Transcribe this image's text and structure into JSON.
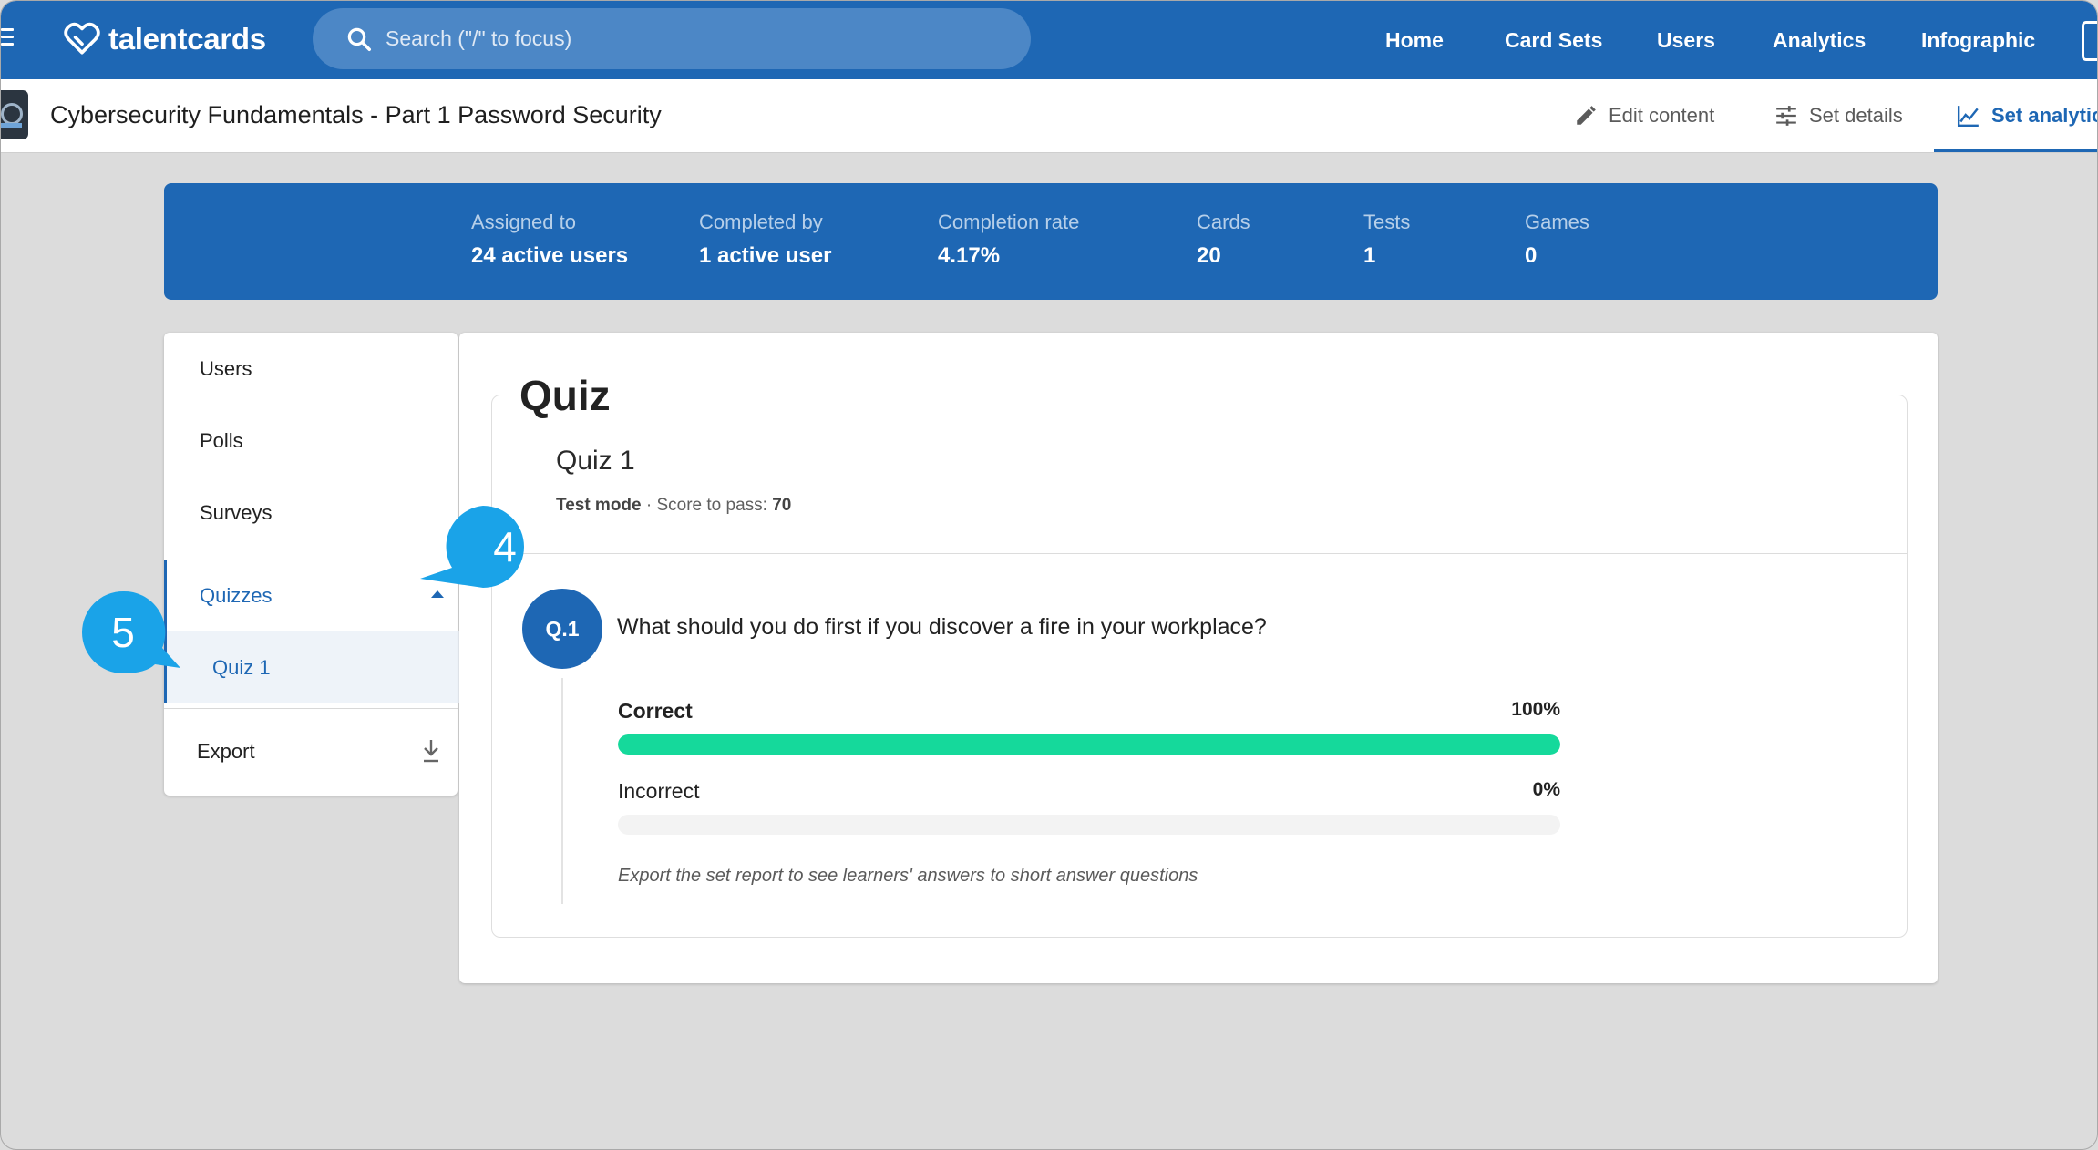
{
  "topbar": {
    "logo_text": "talentcards",
    "search_placeholder": "Search (\"/\" to focus)",
    "nav": [
      "Home",
      "Card Sets",
      "Users",
      "Analytics",
      "Infographic"
    ]
  },
  "subheader": {
    "title": "Cybersecurity Fundamentals - Part 1 Password Security",
    "tabs": [
      {
        "label": "Edit content",
        "icon": "pencil-icon"
      },
      {
        "label": "Set details",
        "icon": "sliders-icon"
      },
      {
        "label": "Set analytics",
        "icon": "line-chart-icon"
      }
    ]
  },
  "stats": [
    {
      "label": "Assigned to",
      "value": "24 active users"
    },
    {
      "label": "Completed by",
      "value": "1 active user"
    },
    {
      "label": "Completion rate",
      "value": "4.17%"
    },
    {
      "label": "Cards",
      "value": "20"
    },
    {
      "label": "Tests",
      "value": "1"
    },
    {
      "label": "Games",
      "value": "0"
    }
  ],
  "menu": {
    "items": [
      "Users",
      "Polls",
      "Surveys",
      "Quizzes"
    ],
    "sub_item": "Quiz 1",
    "export": "Export"
  },
  "quiz": {
    "heading": "Quiz",
    "name": "Quiz 1",
    "mode": "Test mode",
    "meta_sep": " · Score to pass: ",
    "pass_score": "70",
    "question": {
      "number": "Q.1",
      "text": "What should you do first if you discover a fire in your workplace?",
      "answers": [
        {
          "label": "Correct",
          "pct_text": "100%",
          "fraction": 1.0
        },
        {
          "label": "Incorrect",
          "pct_text": "0%",
          "fraction": 0.0
        }
      ]
    },
    "note": "Export the set report to see learners' answers to short answer questions"
  },
  "callouts": [
    "4",
    "5"
  ],
  "colors": {
    "brand": "#1e67b4",
    "correct_bar": "#15d99b",
    "callout": "#1aa3e8"
  }
}
